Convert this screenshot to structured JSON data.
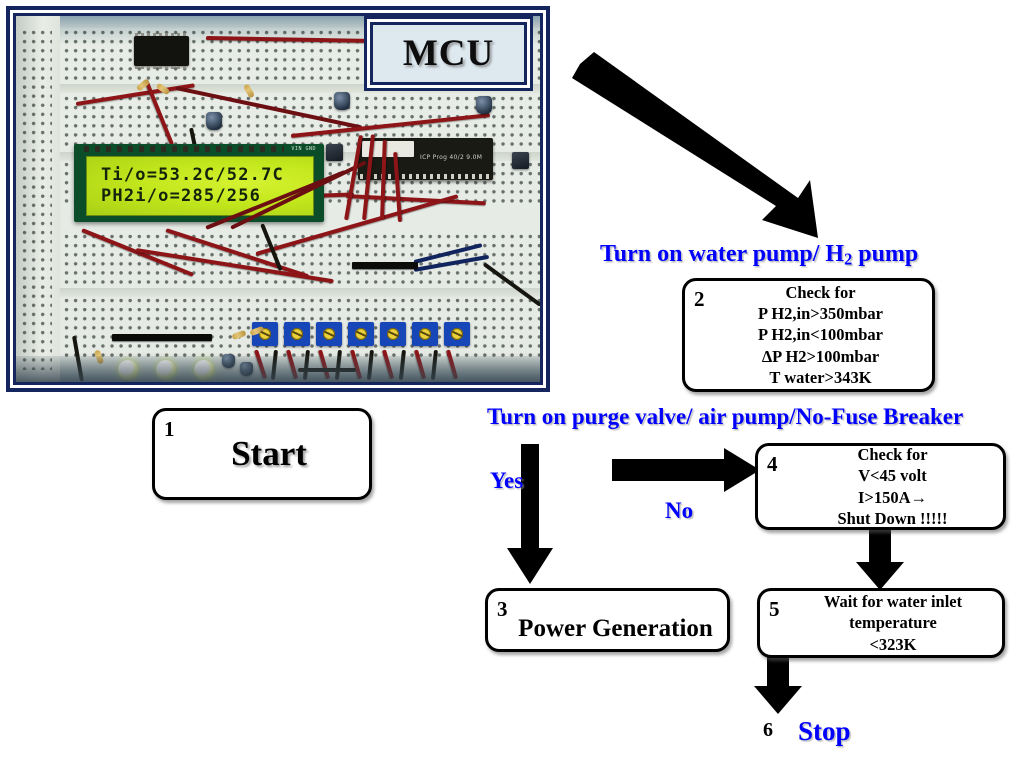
{
  "figure": {
    "type": "flowchart-with-photo",
    "photo": {
      "callout_label": "MCU",
      "lcd": {
        "line1": "Ti/o=53.2C/52.7C",
        "line2": "PH2i/o=285/256",
        "module_marking": "VIN GND"
      },
      "devboard_marking": "ICP Prog 40/2  9.0M"
    },
    "headings": [
      {
        "id": "h1",
        "text_before": "Turn on water pump/ H",
        "sub": "2",
        "text_after": " pump"
      },
      {
        "id": "h2",
        "text": "Turn on purge valve/ air pump/No-Fuse Breaker"
      }
    ],
    "edge_labels": {
      "yes": "Yes",
      "no": "No"
    },
    "nodes": [
      {
        "num": "1",
        "kind": "start",
        "lines": [
          "Start"
        ]
      },
      {
        "num": "2",
        "kind": "decision",
        "lines": [
          "Check for",
          "P  H2,in>350mbar",
          "P  H2,in<100mbar",
          "ΔP  H2>100mbar",
          "T  water>343K"
        ]
      },
      {
        "num": "3",
        "kind": "process",
        "lines": [
          "Power Generation"
        ]
      },
      {
        "num": "4",
        "kind": "decision",
        "lines": [
          "Check for",
          "V<45 volt",
          "I>150A→",
          "Shut Down !!!!!"
        ]
      },
      {
        "num": "5",
        "kind": "process",
        "lines": [
          "Wait for water inlet",
          "temperature",
          "<323K"
        ]
      },
      {
        "num": "6",
        "kind": "terminator",
        "lines": [
          "Stop"
        ]
      }
    ],
    "colors": {
      "accent_blue": "#0000ff",
      "frame_navy": "#15265e",
      "lcd_green": "#c3e71c",
      "stroke_black": "#000000"
    }
  }
}
